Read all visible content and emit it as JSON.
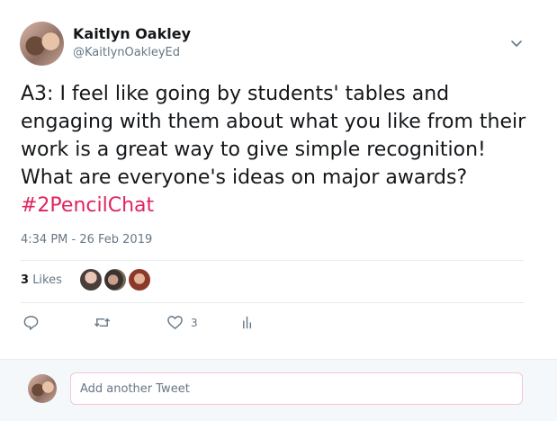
{
  "tweet": {
    "author_name": "Kaitlyn Oakley",
    "author_handle": "@KaitlynOakleyEd",
    "text": "A3: I feel like going by students' tables and engaging with them about what you like from their work is a great way to give simple recognition! What are everyone's ideas on major awards? ",
    "hashtag": "#2PencilChat",
    "timestamp": "4:34 PM - 26 Feb 2019"
  },
  "stats": {
    "likes_count": "3",
    "likes_label": "Likes"
  },
  "actions": {
    "reply_icon": "reply-icon",
    "retweet_icon": "retweet-icon",
    "like_icon": "heart-icon",
    "like_count": "3",
    "analytics_icon": "analytics-icon"
  },
  "reply_box": {
    "placeholder": "Add another Tweet"
  },
  "colors": {
    "hashtag": "#e0245e",
    "secondary_text": "#657786",
    "divider": "#e6ecf0",
    "reply_bg": "#f5f8fa"
  }
}
